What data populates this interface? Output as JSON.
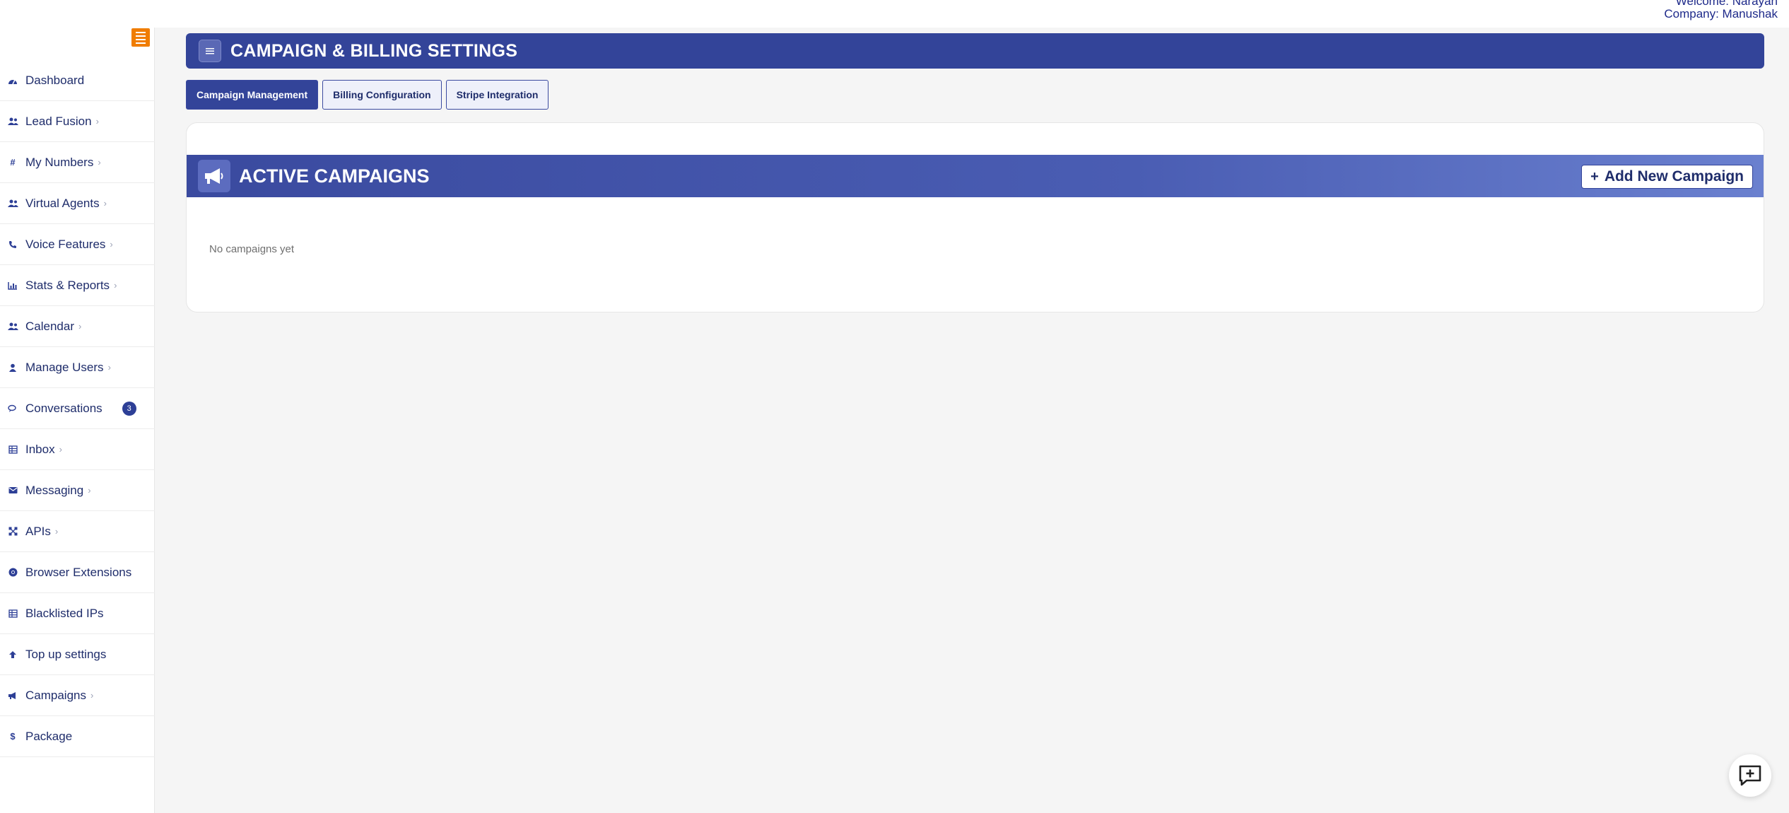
{
  "topbar": {
    "welcome": "Welcome: Narayan",
    "company": "Company: Manushak"
  },
  "sidebar": {
    "items": [
      {
        "label": "Dashboard",
        "icon": "dashboard-icon",
        "chevron": false
      },
      {
        "label": "Lead Fusion",
        "icon": "users-icon",
        "chevron": true
      },
      {
        "label": "My Numbers",
        "icon": "hash-icon",
        "chevron": true
      },
      {
        "label": "Virtual Agents",
        "icon": "users-icon",
        "chevron": true
      },
      {
        "label": "Voice Features",
        "icon": "phone-icon",
        "chevron": true
      },
      {
        "label": "Stats & Reports",
        "icon": "bar-chart-icon",
        "chevron": true
      },
      {
        "label": "Calendar",
        "icon": "users-icon",
        "chevron": true
      },
      {
        "label": "Manage Users",
        "icon": "user-icon",
        "chevron": true
      },
      {
        "label": "Conversations",
        "icon": "chat-icon",
        "chevron": false,
        "badge": "3"
      },
      {
        "label": "Inbox",
        "icon": "table-icon",
        "chevron": true
      },
      {
        "label": "Messaging",
        "icon": "envelope-icon",
        "chevron": true
      },
      {
        "label": "APIs",
        "icon": "api-icon",
        "chevron": true
      },
      {
        "label": "Browser Extensions",
        "icon": "chrome-icon",
        "chevron": false
      },
      {
        "label": "Blacklisted IPs",
        "icon": "table-icon",
        "chevron": false
      },
      {
        "label": "Top up settings",
        "icon": "arrow-up-icon",
        "chevron": false
      },
      {
        "label": "Campaigns",
        "icon": "megaphone-icon",
        "chevron": true
      },
      {
        "label": "Package",
        "icon": "dollar-icon",
        "chevron": false
      }
    ]
  },
  "header": {
    "title": "CAMPAIGN & BILLING SETTINGS"
  },
  "tabs": [
    {
      "label": "Campaign Management",
      "active": true
    },
    {
      "label": "Billing Configuration",
      "active": false
    },
    {
      "label": "Stripe Integration",
      "active": false
    }
  ],
  "campaigns": {
    "title": "ACTIVE CAMPAIGNS",
    "add_button": "Add New Campaign",
    "add_plus": "+",
    "empty_text": "No campaigns yet"
  },
  "colors": {
    "primary": "#334499",
    "sidebar_toggle": "#f07d00"
  }
}
